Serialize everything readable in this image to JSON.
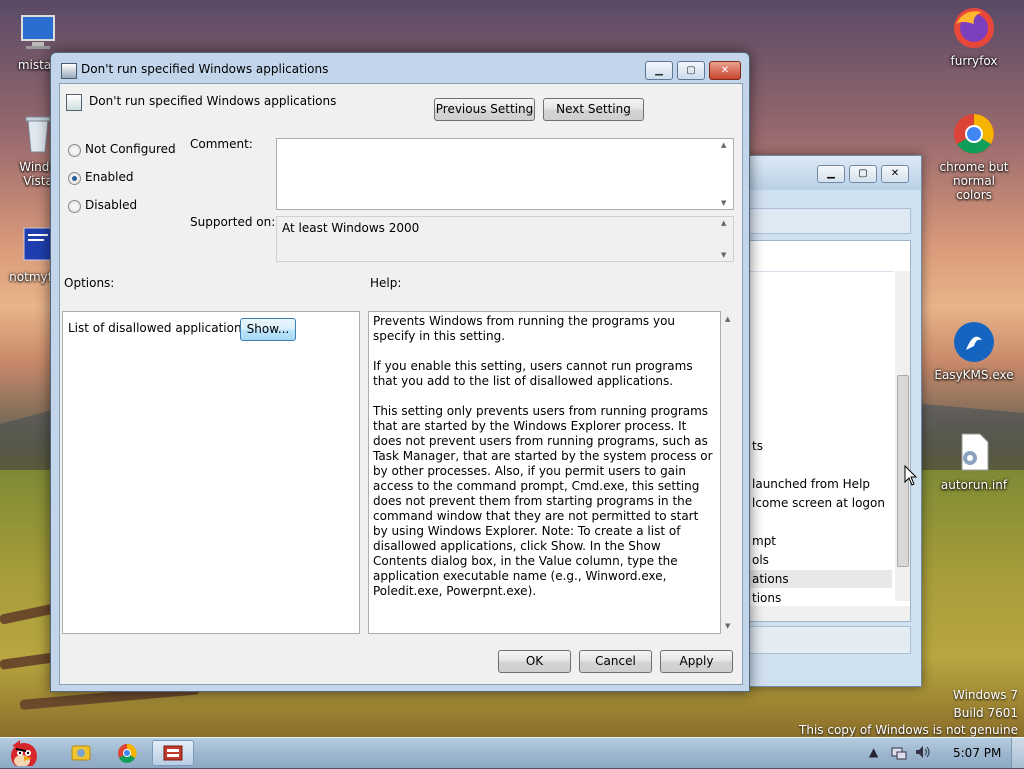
{
  "desktop": {
    "icons_left": [
      {
        "name": "computer-icon",
        "label": "mistak"
      },
      {
        "name": "recycle-bin-icon",
        "label": "Windo\nVista"
      },
      {
        "name": "bsod-file-icon",
        "label": "notmyfau"
      }
    ],
    "icons_right": [
      {
        "name": "firefox-icon",
        "label": "furryfox"
      },
      {
        "name": "chrome-icon",
        "label": "chrome but\nnormal colors"
      },
      {
        "name": "easykms-icon",
        "label": "EasyKMS.exe"
      },
      {
        "name": "autorun-file-icon",
        "label": "autorun.inf"
      }
    ],
    "watermark": {
      "line1": "Windows 7",
      "line2": "Build 7601",
      "line3": "This copy of Windows is not genuine"
    }
  },
  "background_window": {
    "rows": [
      "ts",
      "launched from Help",
      "lcome screen at logon",
      "mpt",
      "ols",
      "ations",
      "tions"
    ]
  },
  "dialog": {
    "window_title": "Don't run specified Windows applications",
    "header_title": "Don't run specified Windows applications",
    "previous_setting_label": "Previous Setting",
    "next_setting_label": "Next Setting",
    "radio_options": [
      {
        "label": "Not Configured",
        "selected": false
      },
      {
        "label": "Enabled",
        "selected": true
      },
      {
        "label": "Disabled",
        "selected": false
      }
    ],
    "comment_label": "Comment:",
    "comment_value": "",
    "supported_on_label": "Supported on:",
    "supported_on_value": "At least Windows 2000",
    "options_label": "Options:",
    "help_label": "Help:",
    "options": {
      "list_label": "List of disallowed applications",
      "show_button_label": "Show..."
    },
    "help_paragraphs": [
      "Prevents Windows from running the programs you specify in this setting.",
      "If you enable this setting, users cannot run programs that you add to the list of disallowed applications.",
      "This setting only prevents users from running programs that are started by the Windows Explorer process. It does not prevent users from running programs, such as Task Manager, that are started by the system process or by other processes. Also, if you permit users to gain access to the command prompt, Cmd.exe, this setting does not prevent them from starting programs in the command window that they are not permitted to start by using Windows Explorer. Note: To create a list of disallowed applications, click Show. In the Show Contents dialog box, in the Value column, type the application executable name (e.g., Winword.exe, Poledit.exe, Powerpnt.exe)."
    ],
    "ok_label": "OK",
    "cancel_label": "Cancel",
    "apply_label": "Apply"
  },
  "taskbar": {
    "buttons": [
      "start-button",
      "explorer-icon",
      "chrome-icon",
      "group-policy-icon"
    ],
    "clock": "5:07 PM"
  },
  "colors": {
    "window_frame": "#c3d5ea",
    "taskbar": "#9eb7cf",
    "dialog_client": "#f0f0f0"
  }
}
